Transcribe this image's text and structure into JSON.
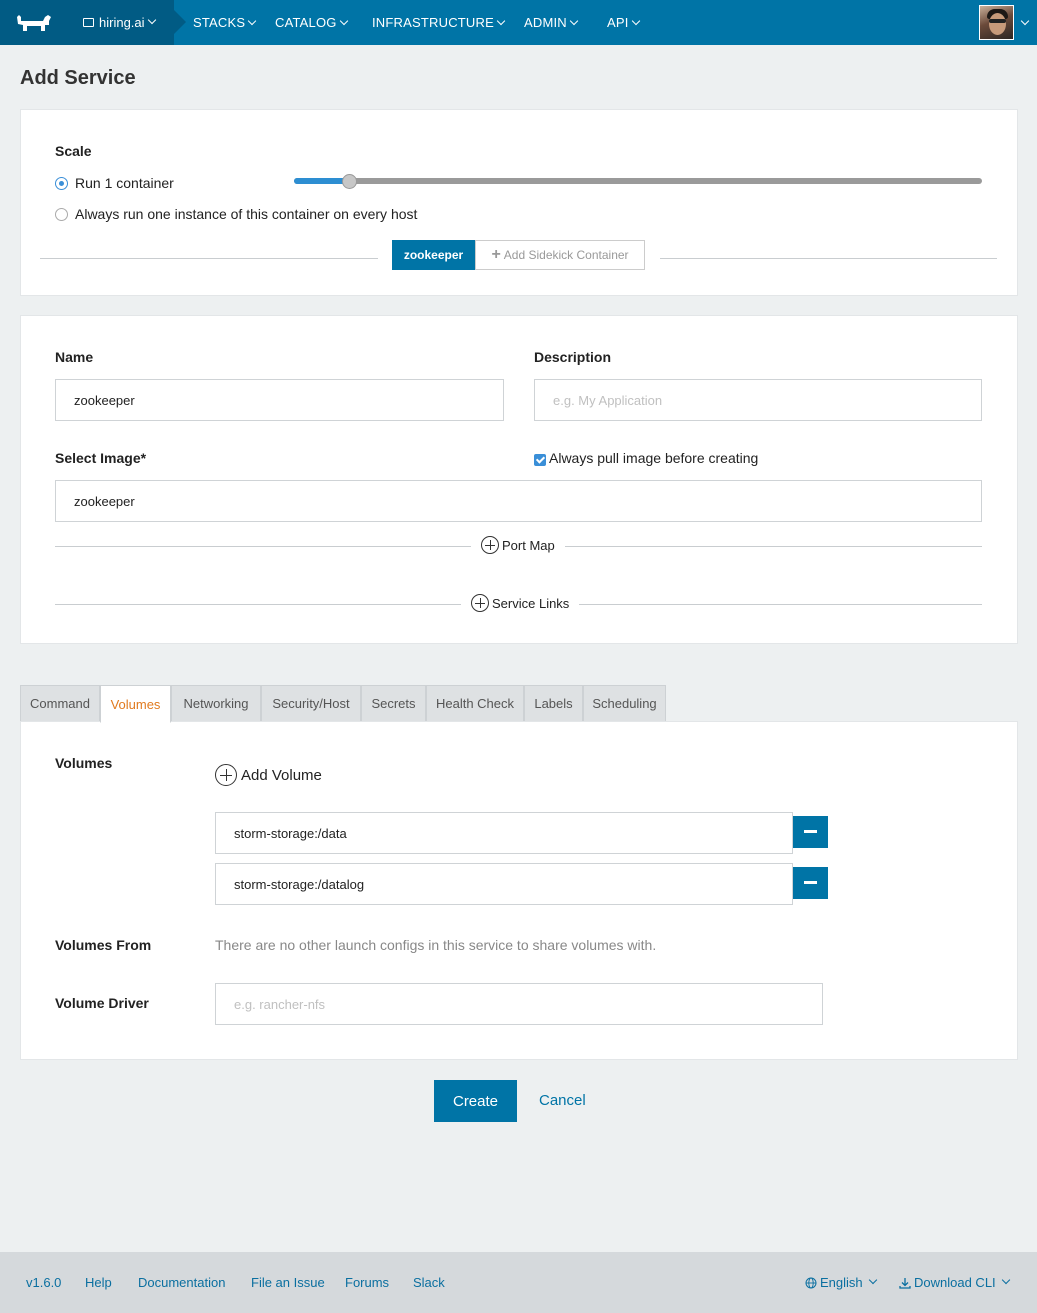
{
  "header": {
    "environment": "hiring.ai",
    "nav": [
      "STACKS",
      "CATALOG",
      "INFRASTRUCTURE",
      "ADMIN",
      "API"
    ]
  },
  "page_title": "Add Service",
  "scale": {
    "label": "Scale",
    "option_run": "Run 1 container",
    "option_every_host": "Always run one instance of this container on every host",
    "slider_value": 1,
    "selected": "run"
  },
  "sidekick": {
    "active": "zookeeper",
    "add_label": "Add Sidekick Container"
  },
  "form": {
    "name_label": "Name",
    "name_value": "zookeeper",
    "description_label": "Description",
    "description_placeholder": "e.g. My Application",
    "image_label": "Select Image*",
    "image_value": "zookeeper",
    "always_pull_label": "Always pull image before creating",
    "port_map": "Port Map",
    "service_links": "Service Links"
  },
  "tabs": [
    "Command",
    "Volumes",
    "Networking",
    "Security/Host",
    "Secrets",
    "Health Check",
    "Labels",
    "Scheduling"
  ],
  "active_tab": "Volumes",
  "volumes": {
    "label": "Volumes",
    "add_label": "Add Volume",
    "items": [
      "storm-storage:/data",
      "storm-storage:/datalog"
    ],
    "from_label": "Volumes From",
    "from_note": "There are no other launch configs in this service to share volumes with.",
    "driver_label": "Volume Driver",
    "driver_placeholder": "e.g. rancher-nfs"
  },
  "actions": {
    "create": "Create",
    "cancel": "Cancel"
  },
  "footer": {
    "version": "v1.6.0",
    "links": [
      "Help",
      "Documentation",
      "File an Issue",
      "Forums",
      "Slack"
    ],
    "language": "English",
    "download": "Download CLI"
  },
  "colors": {
    "primary": "#0074a6",
    "header_dark": "#015b84",
    "active_tab": "#e07a1f",
    "radio": "#3a8fd8"
  }
}
